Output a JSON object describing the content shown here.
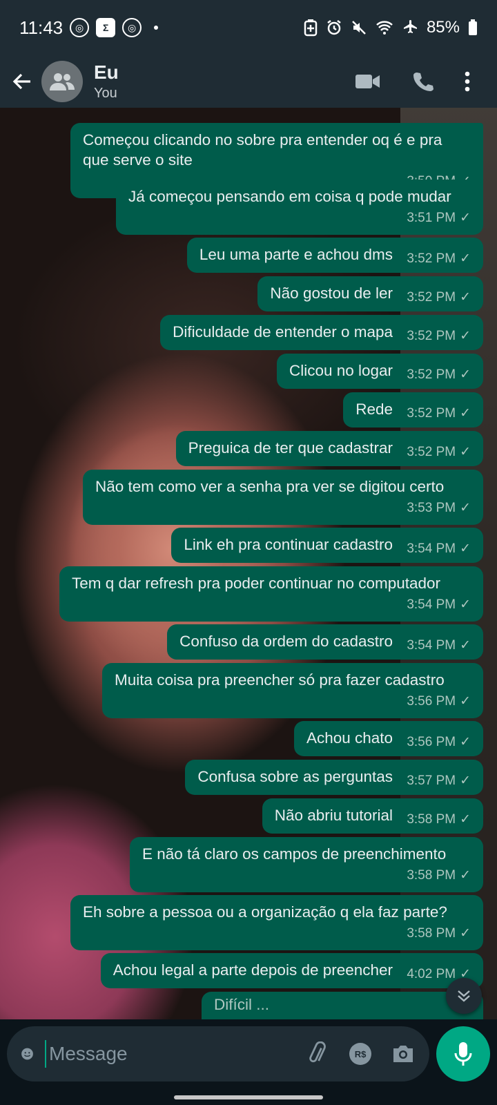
{
  "status": {
    "time": "11:43",
    "battery": "85%"
  },
  "header": {
    "title": "Eu",
    "subtitle": "You"
  },
  "messages": [
    {
      "text": "Começou clicando no sobre pra entender oq é e pra que serve o site",
      "time": "3:50 PM"
    },
    {
      "text": "Já começou pensando em coisa q pode mudar",
      "time": "3:51 PM"
    },
    {
      "text": "Leu uma parte e achou dms",
      "time": "3:52 PM"
    },
    {
      "text": "Não gostou de ler",
      "time": "3:52 PM"
    },
    {
      "text": "Dificuldade de entender o mapa",
      "time": "3:52 PM"
    },
    {
      "text": "Clicou no logar",
      "time": "3:52 PM"
    },
    {
      "text": "Rede",
      "time": "3:52 PM"
    },
    {
      "text": "Preguica de ter que cadastrar",
      "time": "3:52 PM"
    },
    {
      "text": "Não tem como ver a senha pra ver se digitou certo",
      "time": "3:53 PM"
    },
    {
      "text": "Link eh pra continuar cadastro",
      "time": "3:54 PM"
    },
    {
      "text": "Tem q dar refresh pra poder continuar no computador",
      "time": "3:54 PM"
    },
    {
      "text": "Confuso da ordem do cadastro",
      "time": "3:54 PM"
    },
    {
      "text": "Muita coisa pra preencher só pra fazer cadastro",
      "time": "3:56 PM"
    },
    {
      "text": "Achou chato",
      "time": "3:56 PM"
    },
    {
      "text": "Confusa sobre as perguntas",
      "time": "3:57 PM"
    },
    {
      "text": "Não abriu tutorial",
      "time": "3:58 PM"
    },
    {
      "text": "E não tá claro os campos de preenchimento",
      "time": "3:58 PM"
    },
    {
      "text": "Eh sobre a pessoa ou a organização q ela faz parte?",
      "time": "3:58 PM"
    },
    {
      "text": "Achou legal a parte depois de preencher",
      "time": "4:02 PM"
    },
    {
      "text": "Difícil ... ",
      "time": ""
    }
  ],
  "input": {
    "placeholder": "Message"
  },
  "colors": {
    "bubble_out": "#005c4b",
    "accent": "#00a884",
    "header": "#1f2c34"
  }
}
